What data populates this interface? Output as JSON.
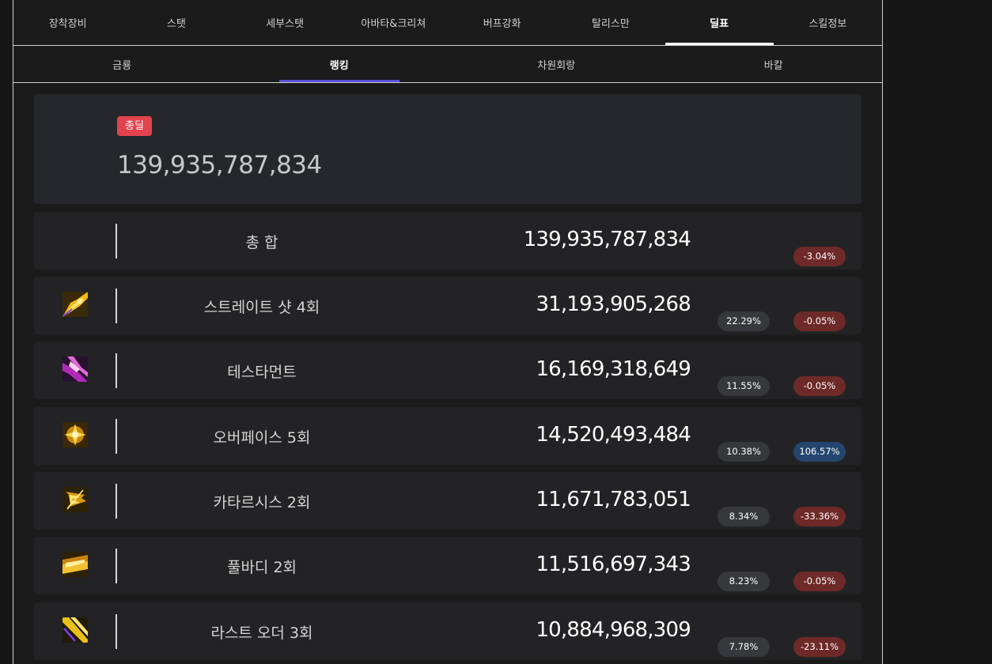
{
  "top_tabs": [
    "장착장비",
    "스탯",
    "세부스탯",
    "아바타&크리쳐",
    "버프강화",
    "탈리스만",
    "딜표",
    "스킬정보"
  ],
  "sub_tabs": [
    "금룡",
    "랭킹",
    "차원회랑",
    "바칼"
  ],
  "summary": {
    "badge": "총딜",
    "value": "139,935,787,834"
  },
  "rows": [
    {
      "name": "총 합",
      "damage": "139,935,787,834",
      "share": "",
      "change": "-3.04%",
      "icon": ""
    },
    {
      "name": "스트레이트 샷 4회",
      "damage": "31,193,905,268",
      "share": "22.29%",
      "change": "-0.05%",
      "icon": "straight-shot-skill-icon"
    },
    {
      "name": "테스타먼트",
      "damage": "16,169,318,649",
      "share": "11.55%",
      "change": "-0.05%",
      "icon": "testament-skill-icon"
    },
    {
      "name": "오버페이스 5회",
      "damage": "14,520,493,484",
      "share": "10.38%",
      "change": "106.57%",
      "icon": "overpace-skill-icon"
    },
    {
      "name": "카타르시스 2회",
      "damage": "11,671,783,051",
      "share": "8.34%",
      "change": "-33.36%",
      "icon": "catharsis-skill-icon"
    },
    {
      "name": "풀바디 2회",
      "damage": "11,516,697,343",
      "share": "8.23%",
      "change": "-0.05%",
      "icon": "full-body-skill-icon"
    },
    {
      "name": "라스트 오더 3회",
      "damage": "10,884,968,309",
      "share": "7.78%",
      "change": "-23.11%",
      "icon": "last-order-skill-icon"
    }
  ],
  "colors": {
    "background": "#1b1b1b",
    "active_sub_tab_underline": "#5b4fd6",
    "total_badge": "#e2434f",
    "negative_change": "#6e2a28",
    "positive_change": "#24466e",
    "share_pill": "#37383b"
  }
}
